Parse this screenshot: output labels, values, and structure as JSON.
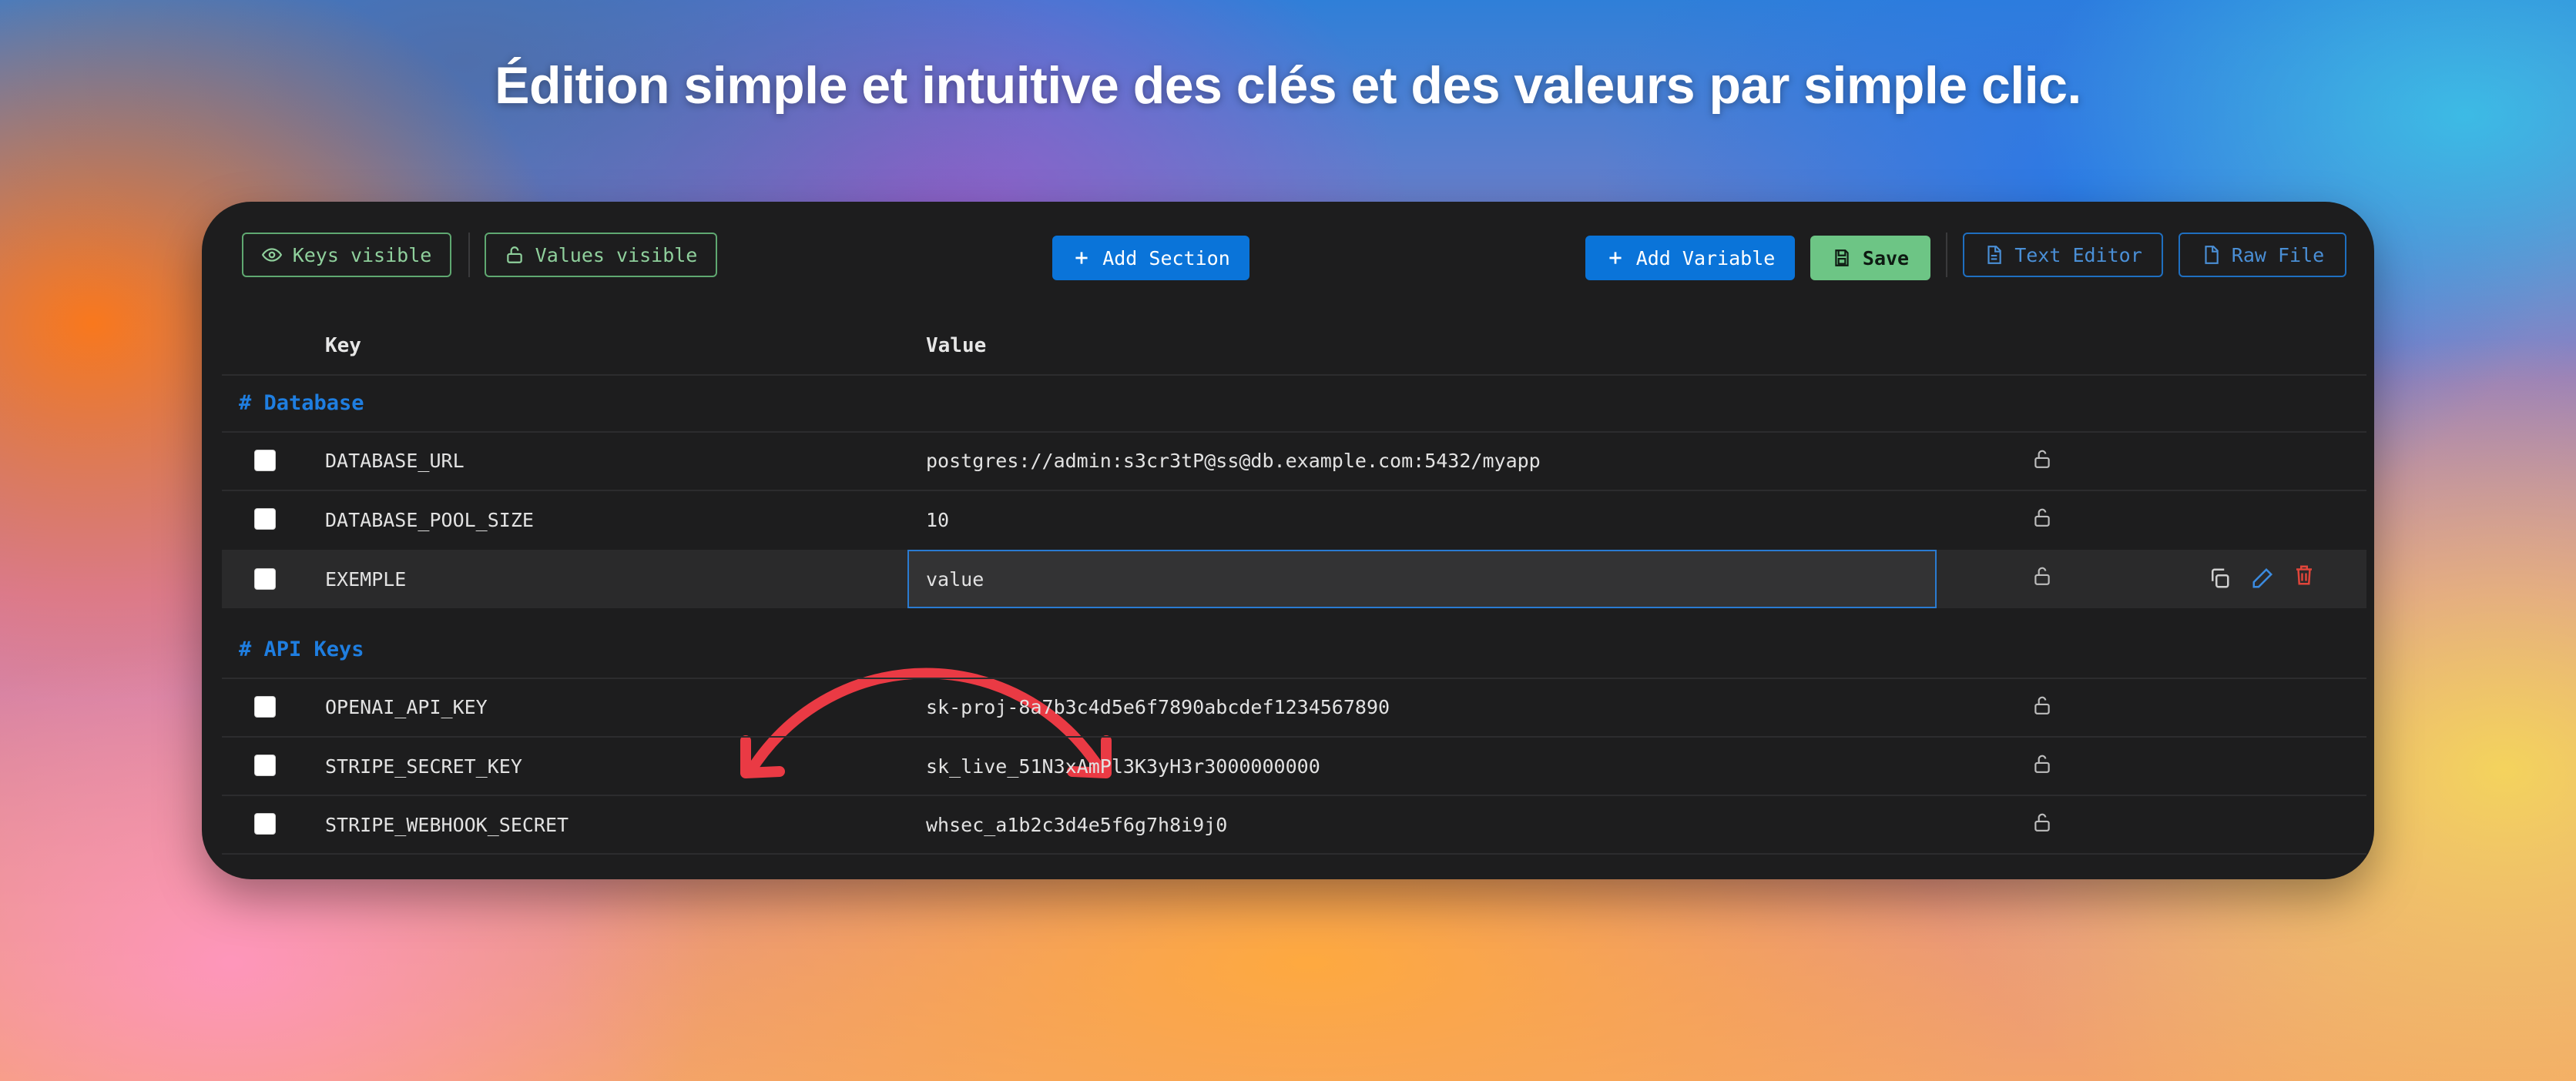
{
  "headline": "Édition simple et intuitive des clés et des valeurs par simple clic.",
  "toolbar": {
    "keys_visible": "Keys visible",
    "values_visible": "Values visible",
    "add_section": "Add Section",
    "add_variable": "Add Variable",
    "save": "Save",
    "text_editor": "Text Editor",
    "raw_file": "Raw File"
  },
  "table": {
    "headers": {
      "key": "Key",
      "value": "Value"
    },
    "sections": [
      {
        "title": "# Database",
        "rows": [
          {
            "key": "DATABASE_URL",
            "value": "postgres://admin:s3cr3tP@ss@db.example.com:5432/myapp"
          },
          {
            "key": "DATABASE_POOL_SIZE",
            "value": "10"
          },
          {
            "key": "EXEMPLE",
            "value": "value",
            "editing": true
          }
        ]
      },
      {
        "title": "# API Keys",
        "rows": [
          {
            "key": "OPENAI_API_KEY",
            "value": "sk-proj-8a7b3c4d5e6f7890abcdef1234567890"
          },
          {
            "key": "STRIPE_SECRET_KEY",
            "value": "sk_live_51N3xAmPl3K3yH3r3000000000"
          },
          {
            "key": "STRIPE_WEBHOOK_SECRET",
            "value": "whsec_a1b2c3d4e5f6g7h8i9j0"
          }
        ]
      }
    ]
  },
  "colors": {
    "accent_blue": "#0a74d9",
    "save_green": "#6dc585",
    "section_blue": "#1f7ee0",
    "delete_red": "#e0453a",
    "arrow_red": "#ea3a44"
  },
  "icons": [
    "eye-icon",
    "unlock-icon",
    "plus-icon",
    "save-icon",
    "file-text-icon",
    "file-icon",
    "lock-open-icon",
    "copy-icon",
    "pencil-icon",
    "trash-icon"
  ]
}
